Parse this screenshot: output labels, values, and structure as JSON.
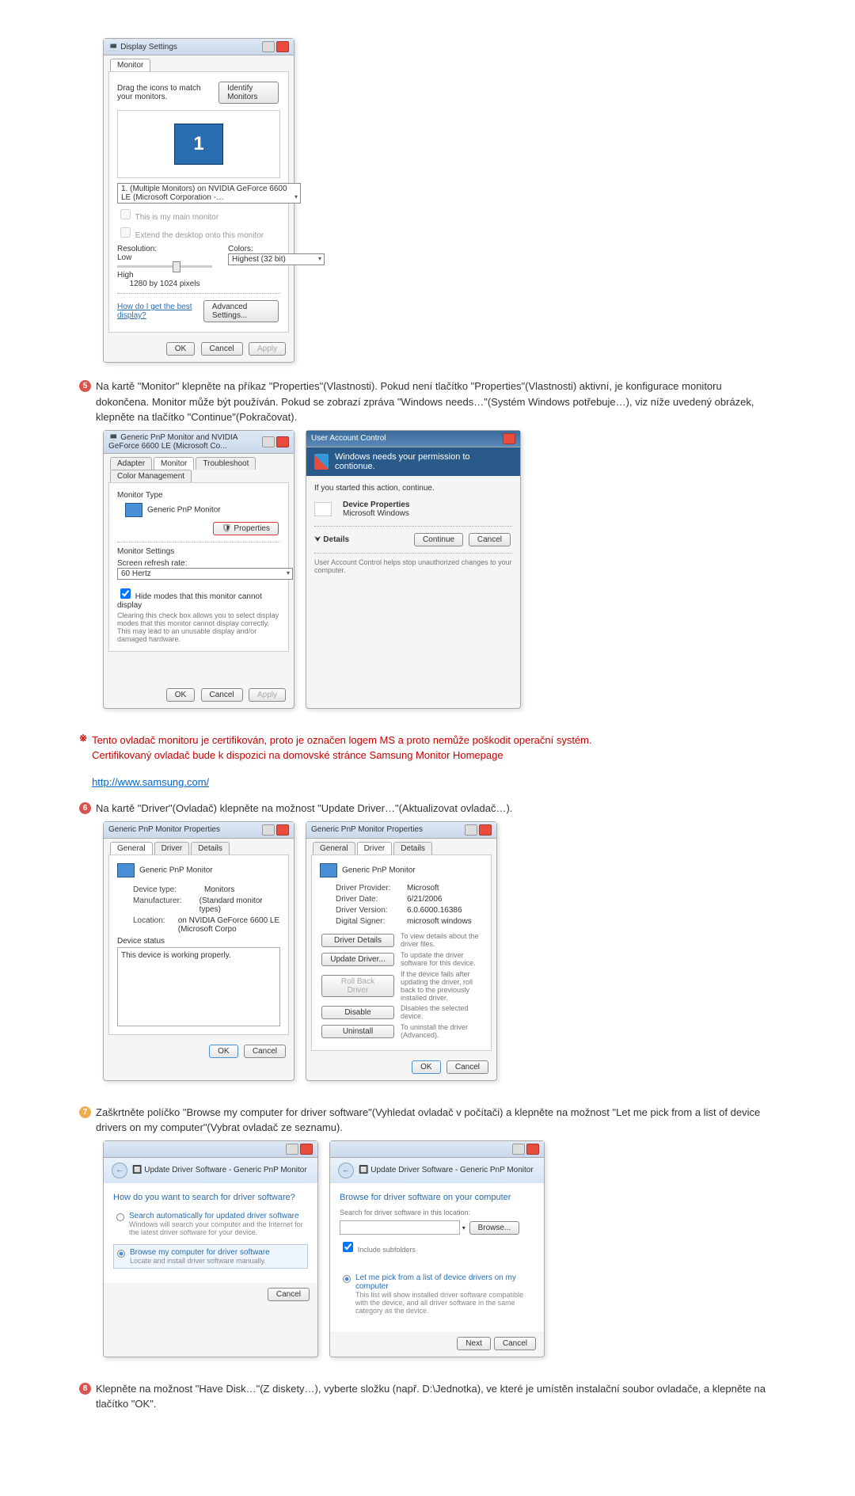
{
  "displaySettings": {
    "title": "Display Settings",
    "tab": "Monitor",
    "instruction": "Drag the icons to match your monitors.",
    "identifyBtn": "Identify Monitors",
    "monitorNumber": "1",
    "deviceDropdown": "1. (Multiple Monitors) on NVIDIA GeForce 6600 LE (Microsoft Corporation -…",
    "chkMain": "This is my main monitor",
    "chkExtend": "Extend the desktop onto this monitor",
    "resolutionLabel": "Resolution:",
    "resLow": "Low",
    "resHigh": "High",
    "resValue": "1280 by 1024 pixels",
    "colorsLabel": "Colors:",
    "colorsValue": "Highest (32 bit)",
    "helpLink": "How do I get the best display?",
    "advancedBtn": "Advanced Settings...",
    "ok": "OK",
    "cancel": "Cancel",
    "apply": "Apply"
  },
  "step5": {
    "num": "5",
    "text": "Na kartě \"Monitor\" klepněte na příkaz \"Properties\"(Vlastnosti). Pokud není tlačítko \"Properties\"(Vlastnosti) aktivní, je konfigurace monitoru dokončena. Monitor může být používán. Pokud se zobrazí zpráva \"Windows needs…\"(Systém Windows potřebuje…), viz níže uvedený obrázek, klepněte na tlačítko \"Continue\"(Pokračovat)."
  },
  "monitorTab": {
    "title": "Generic PnP Monitor and NVIDIA GeForce 6600 LE (Microsoft Co...",
    "tabs": [
      "Adapter",
      "Monitor",
      "Troubleshoot",
      "Color Management"
    ],
    "monitorTypeLabel": "Monitor Type",
    "monitorName": "Generic PnP Monitor",
    "propsBtn": "Properties",
    "settingsLabel": "Monitor Settings",
    "refreshLabel": "Screen refresh rate:",
    "refreshValue": "60 Hertz",
    "hideModes": "Hide modes that this monitor cannot display",
    "hideDesc": "Clearing this check box allows you to select display modes that this monitor cannot display correctly. This may lead to an unusable display and/or damaged hardware.",
    "ok": "OK",
    "cancel": "Cancel",
    "apply": "Apply"
  },
  "uac": {
    "title": "User Account Control",
    "heading": "Windows needs your permission to contionue.",
    "ifStarted": "If you started this action, continue.",
    "program": "Device Properties",
    "publisher": "Microsoft Windows",
    "details": "Details",
    "continue": "Continue",
    "cancel": "Cancel",
    "footer": "User Account Control helps stop unauthorized changes to your computer."
  },
  "note": {
    "mark": "※",
    "line1": "Tento ovladač monitoru je certifikován, proto je označen logem MS a proto nemůže poškodit operační systém.",
    "line2": "Certifikovaný ovladač bude k dispozici na domovské stránce Samsung Monitor Homepage",
    "link": "http://www.samsung.com/"
  },
  "step6": {
    "num": "6",
    "text": "Na kartě \"Driver\"(Ovladač) klepněte na možnost \"Update Driver…\"(Aktualizovat ovladač…)."
  },
  "propsGeneral": {
    "title": "Generic PnP Monitor Properties",
    "tabs": [
      "General",
      "Driver",
      "Details"
    ],
    "name": "Generic PnP Monitor",
    "deviceType": "Device type:",
    "deviceTypeVal": "Monitors",
    "manufacturer": "Manufacturer:",
    "manufacturerVal": "(Standard monitor types)",
    "location": "Location:",
    "locationVal": "on NVIDIA GeForce 6600 LE (Microsoft Corpo",
    "statusLabel": "Device status",
    "statusText": "This device is working properly.",
    "ok": "OK",
    "cancel": "Cancel"
  },
  "propsDriver": {
    "title": "Generic PnP Monitor Properties",
    "tabs": [
      "General",
      "Driver",
      "Details"
    ],
    "name": "Generic PnP Monitor",
    "provider": "Driver Provider:",
    "providerVal": "Microsoft",
    "date": "Driver Date:",
    "dateVal": "6/21/2006",
    "version": "Driver Version:",
    "versionVal": "6.0.6000.16386",
    "signer": "Digital Signer:",
    "signerVal": "microsoft windows",
    "detailsBtn": "Driver Details",
    "detailsDesc": "To view details about the driver files.",
    "updateBtn": "Update Driver...",
    "updateDesc": "To update the driver software for this device.",
    "rollbackBtn": "Roll Back Driver",
    "rollbackDesc": "If the device fails after updating the driver, roll back to the previously installed driver.",
    "disableBtn": "Disable",
    "disableDesc": "Disables the selected device.",
    "uninstallBtn": "Uninstall",
    "uninstallDesc": "To uninstall the driver (Advanced).",
    "ok": "OK",
    "cancel": "Cancel"
  },
  "step7": {
    "num": "7",
    "text": "Zaškrtněte políčko \"Browse my computer for driver software\"(Vyhledat ovladač v počítači) a klepněte na možnost \"Let me pick from a list of device drivers on my computer\"(Vybrat ovladač ze seznamu)."
  },
  "wizard1": {
    "breadcrumb": "Update Driver Software - Generic PnP Monitor",
    "heading": "How do you want to search for driver software?",
    "opt1": "Search automatically for updated driver software",
    "opt1sub": "Windows will search your computer and the Internet for the latest driver software for your device.",
    "opt2": "Browse my computer for driver software",
    "opt2sub": "Locate and install driver software manually.",
    "cancel": "Cancel"
  },
  "wizard2": {
    "breadcrumb": "Update Driver Software - Generic PnP Monitor",
    "heading": "Browse for driver software on your computer",
    "searchLabel": "Search for driver software in this location:",
    "browse": "Browse...",
    "includeSub": "Include subfolders",
    "pick": "Let me pick from a list of device drivers on my computer",
    "pickSub": "This list will show installed driver software compatible with the device, and all driver software in the same category as the device.",
    "next": "Next",
    "cancel": "Cancel"
  },
  "step8": {
    "num": "8",
    "text": "Klepněte na možnost \"Have Disk…\"(Z diskety…), vyberte složku (např. D:\\Jednotka), ve které je umístěn instalační soubor ovladače, a klepněte na tlačítko \"OK\"."
  }
}
